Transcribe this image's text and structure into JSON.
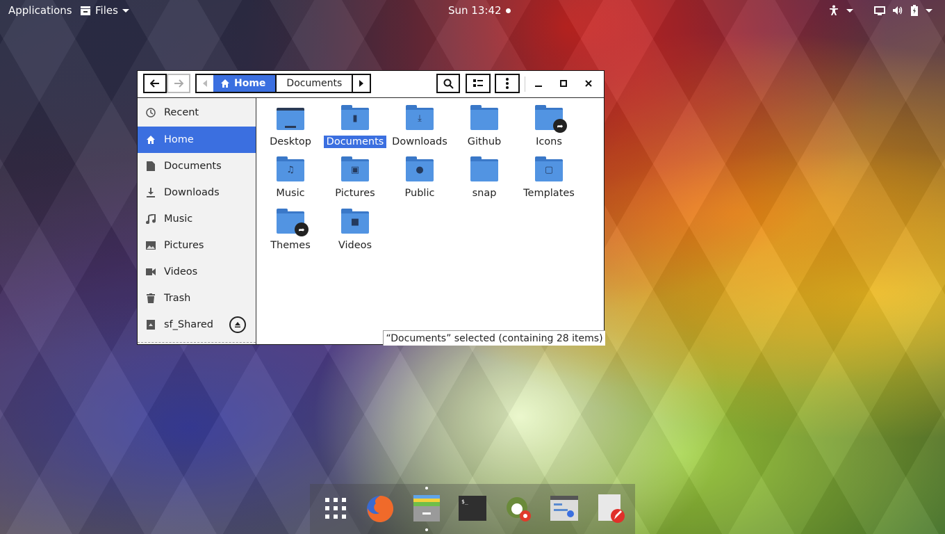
{
  "topbar": {
    "applications": "Applications",
    "files": "Files",
    "clock": "Sun 13:42"
  },
  "window": {
    "pathbar": {
      "home": "Home",
      "documents": "Documents"
    },
    "sidebar": {
      "items": [
        {
          "label": "Recent",
          "icon": "clock-icon"
        },
        {
          "label": "Home",
          "icon": "home-icon"
        },
        {
          "label": "Documents",
          "icon": "document-icon"
        },
        {
          "label": "Downloads",
          "icon": "download-icon"
        },
        {
          "label": "Music",
          "icon": "music-icon"
        },
        {
          "label": "Pictures",
          "icon": "picture-icon"
        },
        {
          "label": "Videos",
          "icon": "video-icon"
        },
        {
          "label": "Trash",
          "icon": "trash-icon"
        },
        {
          "label": "sf_Shared",
          "icon": "drive-icon"
        }
      ]
    },
    "folders": [
      {
        "label": "Desktop"
      },
      {
        "label": "Documents"
      },
      {
        "label": "Downloads"
      },
      {
        "label": "Github"
      },
      {
        "label": "Icons"
      },
      {
        "label": "Music"
      },
      {
        "label": "Pictures"
      },
      {
        "label": "Public"
      },
      {
        "label": "snap"
      },
      {
        "label": "Templates"
      },
      {
        "label": "Themes"
      },
      {
        "label": "Videos"
      }
    ],
    "status": "“Documents” selected  (containing 28 items)"
  },
  "colors": {
    "accent": "#3b6fe0",
    "folder": "#5294e2"
  }
}
